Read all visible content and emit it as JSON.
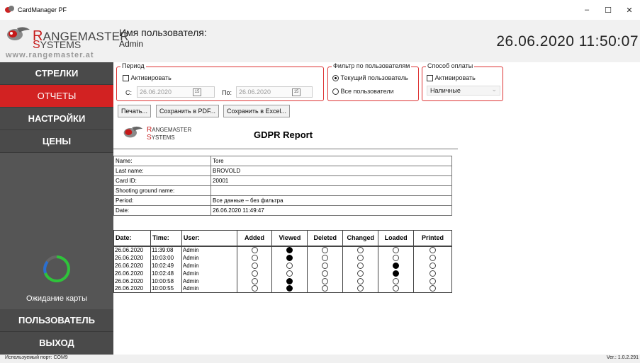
{
  "window": {
    "title": "CardManager PF",
    "minimize": "–",
    "maximize": "☐",
    "close": "✕"
  },
  "header": {
    "logo_r": "R",
    "logo_angemaster": "ANGEMASTER",
    "logo_s": "S",
    "logo_ystems": "YSTEMS",
    "logo_url": "www.rangemaster.at",
    "user_label": "Имя пользователя:",
    "user_name": "Admin",
    "datetime": "26.06.2020  11:50:07"
  },
  "sidebar": {
    "items": [
      {
        "label": "СТРЕЛКИ"
      },
      {
        "label": "ОТЧЕТЫ"
      },
      {
        "label": "НАСТРОЙКИ"
      },
      {
        "label": "ЦЕНЫ"
      },
      {
        "label": "ПОЛЬЗОВАТЕЛЬ"
      },
      {
        "label": "ВЫХОД"
      }
    ],
    "wait_label": "Ожидание карты",
    "active_index": 1
  },
  "filters": {
    "period": {
      "legend": "Период",
      "activate_label": "Активировать",
      "from_label": "С:",
      "from_value": "26.06.2020",
      "to_label": "По:",
      "to_value": "26.06.2020",
      "cal_icon": "15"
    },
    "user_filter": {
      "legend": "Фильтр по пользователям",
      "current_user": "Текущий пользователь",
      "all_users": "Все пользователи"
    },
    "payment": {
      "legend": "Способ оплаты",
      "activate_label": "Активировать",
      "selected": "Наличные",
      "chevron": "⌄"
    }
  },
  "toolbar": {
    "print": "Печать...",
    "save_pdf": "Сохранить в PDF...",
    "save_excel": "Сохранить в Excel..."
  },
  "report": {
    "logo_r": "R",
    "logo_angemaster": "ANGEMASTER",
    "logo_s": "S",
    "logo_ystems": "YSTEMS",
    "title": "GDPR Report",
    "info": [
      {
        "label": "Name:",
        "value": "Tore"
      },
      {
        "label": "Last name:",
        "value": "BROVOLD"
      },
      {
        "label": "Card ID:",
        "value": "20001"
      },
      {
        "label": "Shooting ground name:",
        "value": ""
      },
      {
        "label": "Period:",
        "value": "Все данные – без фильтра"
      },
      {
        "label": "Date:",
        "value": "26.06.2020 11:49:47"
      }
    ],
    "columns": [
      "Date:",
      "Time:",
      "User:",
      "Added",
      "Viewed",
      "Deleted",
      "Changed",
      "Loaded",
      "Printed"
    ],
    "rows": [
      {
        "date": "26.06.2020",
        "time": "11:39:08",
        "user": "Admin",
        "marks": [
          0,
          1,
          0,
          0,
          0,
          0
        ]
      },
      {
        "date": "26.06.2020",
        "time": "10:03:00",
        "user": "Admin",
        "marks": [
          0,
          1,
          0,
          0,
          0,
          0
        ]
      },
      {
        "date": "26.06.2020",
        "time": "10:02:49",
        "user": "Admin",
        "marks": [
          0,
          0,
          0,
          0,
          1,
          0
        ]
      },
      {
        "date": "26.06.2020",
        "time": "10:02:48",
        "user": "Admin",
        "marks": [
          0,
          0,
          0,
          0,
          1,
          0
        ]
      },
      {
        "date": "26.06.2020",
        "time": "10:00:58",
        "user": "Admin",
        "marks": [
          0,
          1,
          0,
          0,
          0,
          0
        ]
      },
      {
        "date": "26.06.2020",
        "time": "10:00:55",
        "user": "Admin",
        "marks": [
          0,
          1,
          0,
          0,
          0,
          0
        ]
      }
    ]
  },
  "statusbar": {
    "port": "Используемый порт: COM9",
    "version": "Ver.: 1.0.2.291"
  },
  "colors": {
    "accent": "#d22222",
    "sidebar": "#555555",
    "header": "#f1f1f1"
  }
}
